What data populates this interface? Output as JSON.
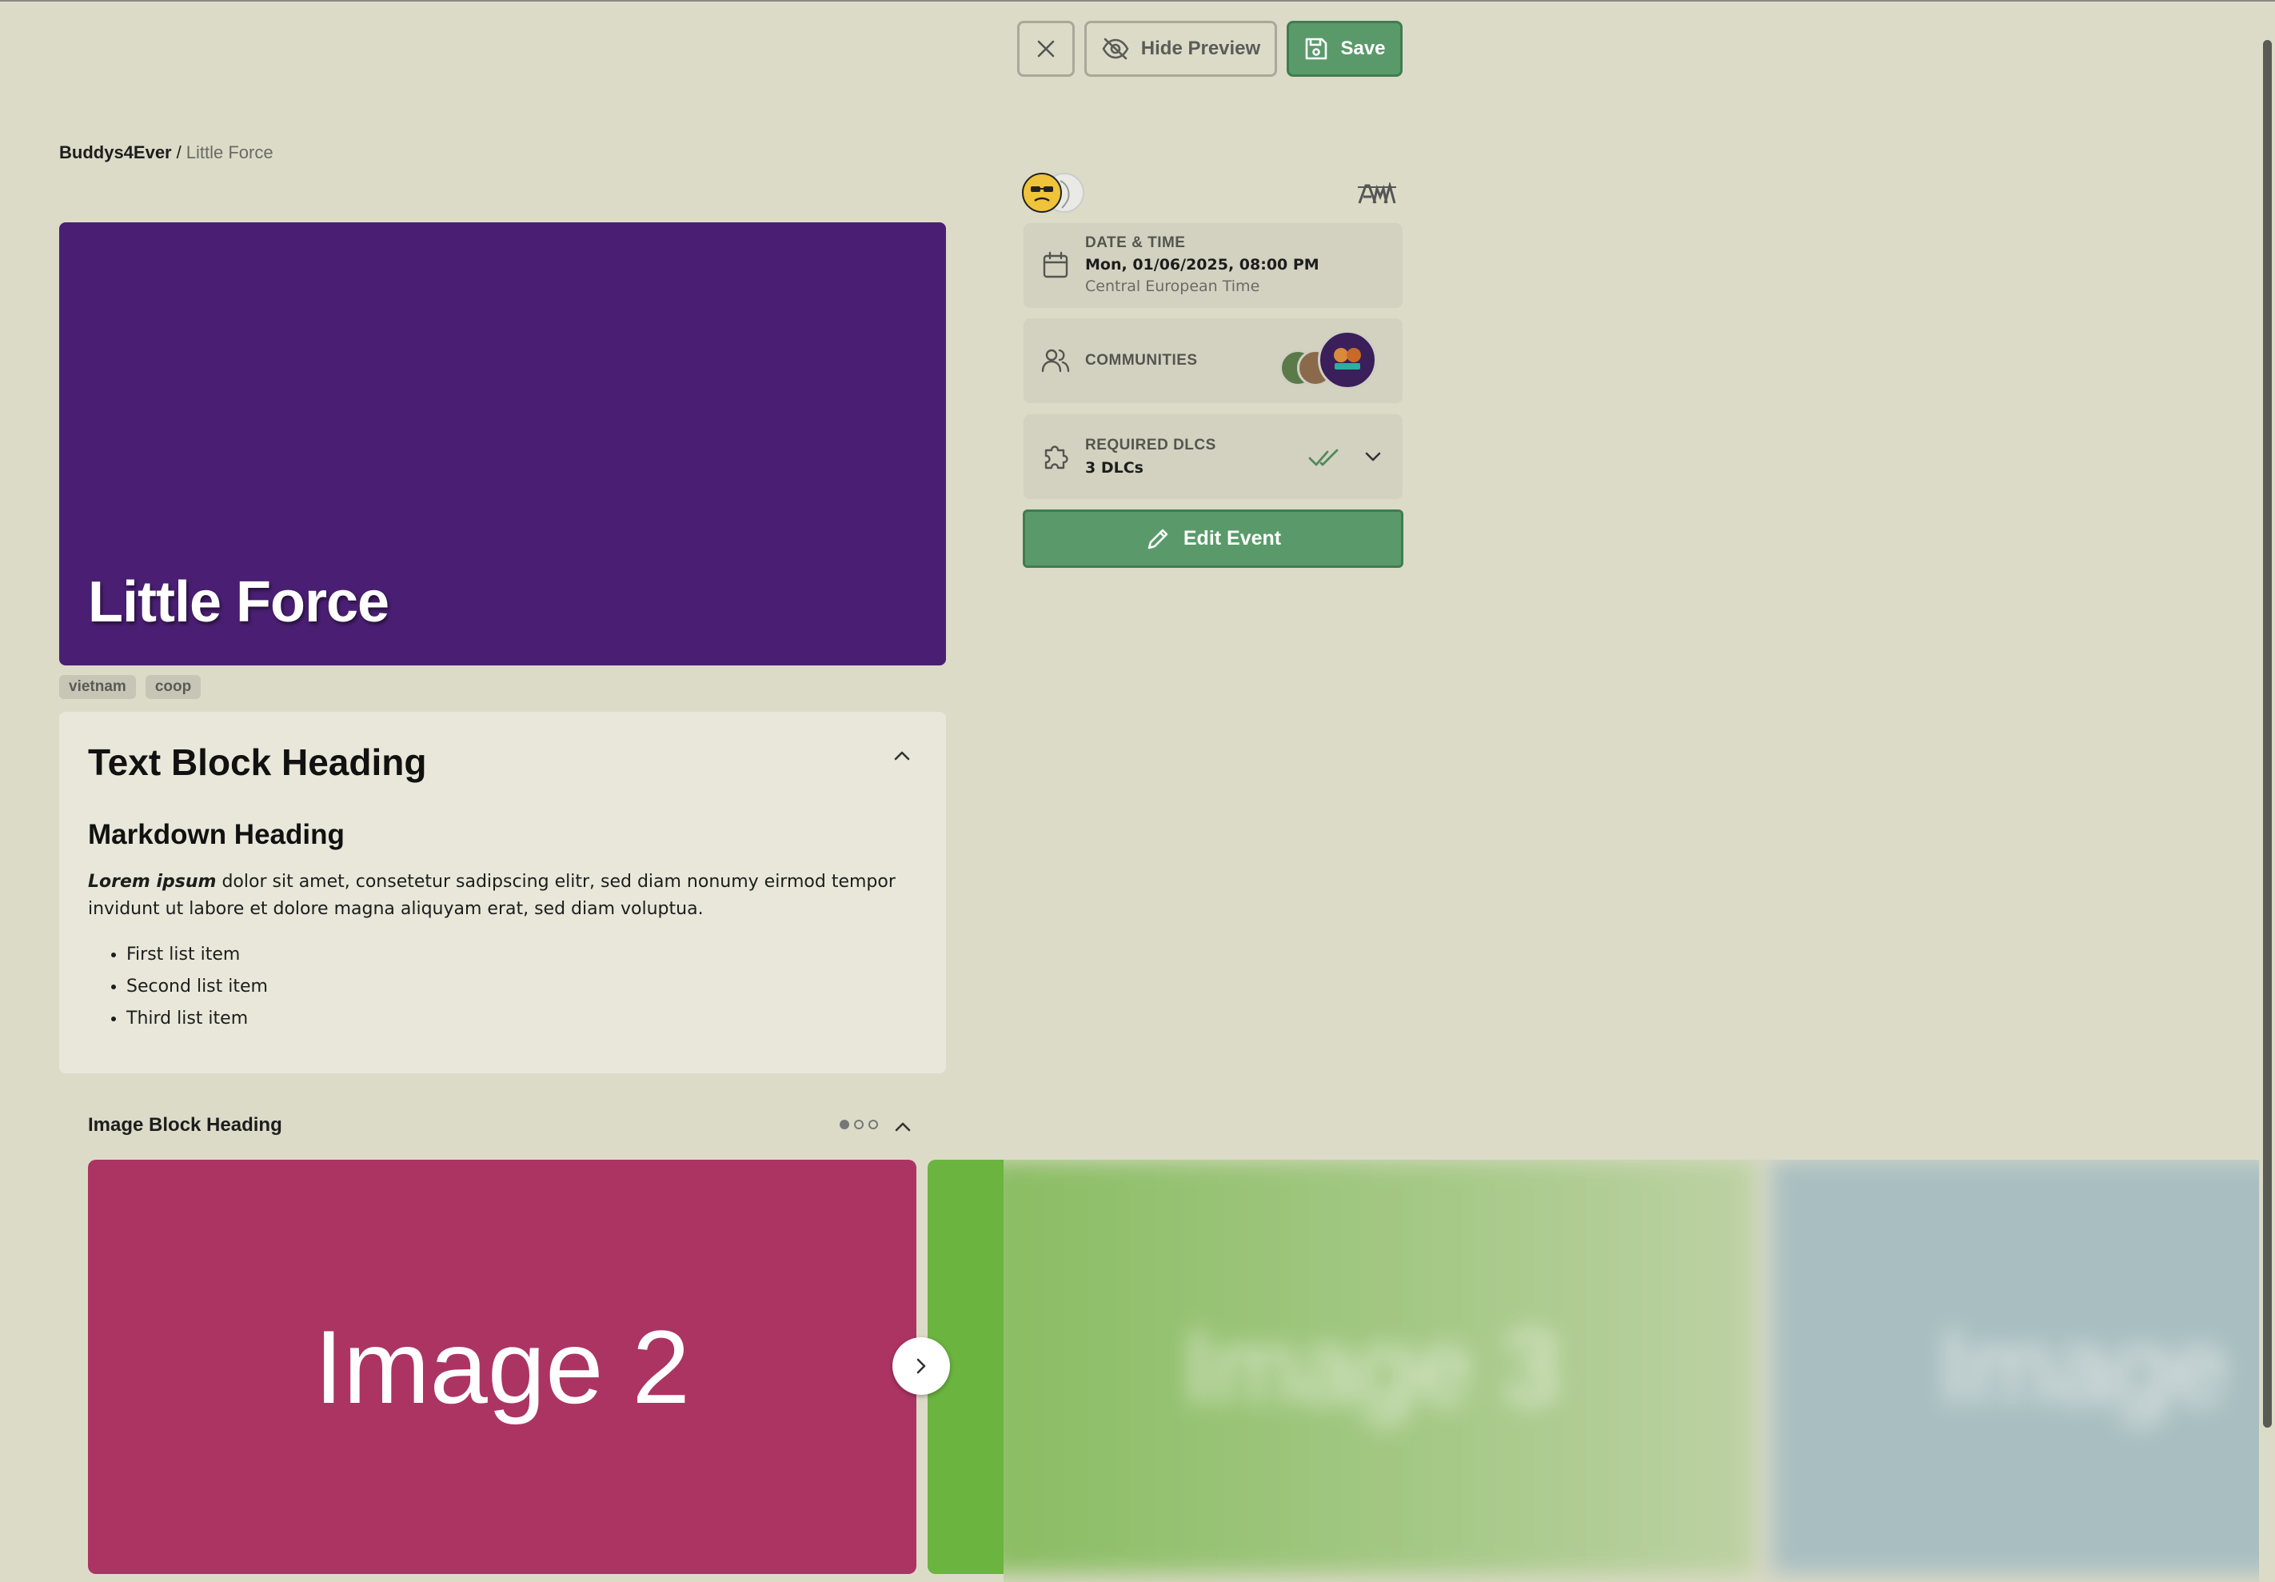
{
  "toolbar": {
    "hide_preview_label": "Hide Preview",
    "save_label": "Save"
  },
  "breadcrumb": {
    "root": "Buddys4Ever",
    "separator": "/",
    "current": "Little Force"
  },
  "hero": {
    "title": "Little Force",
    "background_color": "#4a1f73"
  },
  "tags": [
    "vietnam",
    "coop"
  ],
  "text_block": {
    "heading": "Text Block Heading",
    "markdown_heading": "Markdown Heading",
    "paragraph_bold": "Lorem ipsum",
    "paragraph_rest": " dolor sit amet, consetetur sadipscing elitr, sed diam nonumy eirmod tempor invidunt ut labore et dolore magna aliquyam erat, sed diam voluptua.",
    "list_items": [
      "First list item",
      "Second list item",
      "Third list item"
    ]
  },
  "image_block": {
    "heading": "Image Block Heading",
    "slides": [
      {
        "label": "Image 2",
        "color": "#ac3463"
      },
      {
        "label": "Image 3",
        "color": "#6ab43f"
      },
      {
        "label": "Image",
        "color": "#9eb8c0"
      }
    ],
    "pagination_count": 3,
    "active_page": 1
  },
  "sidebar": {
    "date_time": {
      "label": "DATE & TIME",
      "value": "Mon, 01/06/2025, 08:00 PM",
      "timezone": "Central European Time"
    },
    "communities": {
      "label": "COMMUNITIES"
    },
    "required_dlcs": {
      "label": "REQUIRED DLCS",
      "value": "3 DLCs"
    },
    "edit_label": "Edit Event"
  },
  "colors": {
    "background": "#dcdbc8",
    "accent_green": "#5a9a6a",
    "card_bg": "#d3d2c1",
    "text_block_bg": "#e8e7d9"
  }
}
